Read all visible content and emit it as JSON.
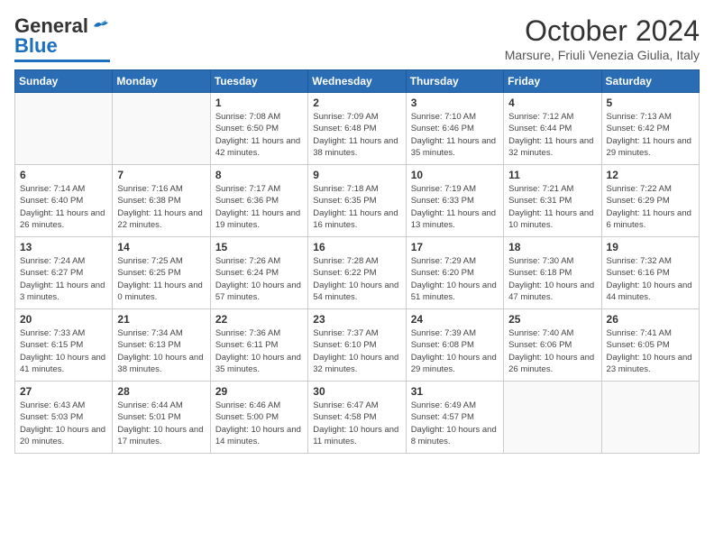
{
  "logo": {
    "general": "General",
    "blue": "Blue"
  },
  "header": {
    "month": "October 2024",
    "location": "Marsure, Friuli Venezia Giulia, Italy"
  },
  "days_of_week": [
    "Sunday",
    "Monday",
    "Tuesday",
    "Wednesday",
    "Thursday",
    "Friday",
    "Saturday"
  ],
  "weeks": [
    [
      {
        "day": "",
        "info": ""
      },
      {
        "day": "",
        "info": ""
      },
      {
        "day": "1",
        "info": "Sunrise: 7:08 AM\nSunset: 6:50 PM\nDaylight: 11 hours and 42 minutes."
      },
      {
        "day": "2",
        "info": "Sunrise: 7:09 AM\nSunset: 6:48 PM\nDaylight: 11 hours and 38 minutes."
      },
      {
        "day": "3",
        "info": "Sunrise: 7:10 AM\nSunset: 6:46 PM\nDaylight: 11 hours and 35 minutes."
      },
      {
        "day": "4",
        "info": "Sunrise: 7:12 AM\nSunset: 6:44 PM\nDaylight: 11 hours and 32 minutes."
      },
      {
        "day": "5",
        "info": "Sunrise: 7:13 AM\nSunset: 6:42 PM\nDaylight: 11 hours and 29 minutes."
      }
    ],
    [
      {
        "day": "6",
        "info": "Sunrise: 7:14 AM\nSunset: 6:40 PM\nDaylight: 11 hours and 26 minutes."
      },
      {
        "day": "7",
        "info": "Sunrise: 7:16 AM\nSunset: 6:38 PM\nDaylight: 11 hours and 22 minutes."
      },
      {
        "day": "8",
        "info": "Sunrise: 7:17 AM\nSunset: 6:36 PM\nDaylight: 11 hours and 19 minutes."
      },
      {
        "day": "9",
        "info": "Sunrise: 7:18 AM\nSunset: 6:35 PM\nDaylight: 11 hours and 16 minutes."
      },
      {
        "day": "10",
        "info": "Sunrise: 7:19 AM\nSunset: 6:33 PM\nDaylight: 11 hours and 13 minutes."
      },
      {
        "day": "11",
        "info": "Sunrise: 7:21 AM\nSunset: 6:31 PM\nDaylight: 11 hours and 10 minutes."
      },
      {
        "day": "12",
        "info": "Sunrise: 7:22 AM\nSunset: 6:29 PM\nDaylight: 11 hours and 6 minutes."
      }
    ],
    [
      {
        "day": "13",
        "info": "Sunrise: 7:24 AM\nSunset: 6:27 PM\nDaylight: 11 hours and 3 minutes."
      },
      {
        "day": "14",
        "info": "Sunrise: 7:25 AM\nSunset: 6:25 PM\nDaylight: 11 hours and 0 minutes."
      },
      {
        "day": "15",
        "info": "Sunrise: 7:26 AM\nSunset: 6:24 PM\nDaylight: 10 hours and 57 minutes."
      },
      {
        "day": "16",
        "info": "Sunrise: 7:28 AM\nSunset: 6:22 PM\nDaylight: 10 hours and 54 minutes."
      },
      {
        "day": "17",
        "info": "Sunrise: 7:29 AM\nSunset: 6:20 PM\nDaylight: 10 hours and 51 minutes."
      },
      {
        "day": "18",
        "info": "Sunrise: 7:30 AM\nSunset: 6:18 PM\nDaylight: 10 hours and 47 minutes."
      },
      {
        "day": "19",
        "info": "Sunrise: 7:32 AM\nSunset: 6:16 PM\nDaylight: 10 hours and 44 minutes."
      }
    ],
    [
      {
        "day": "20",
        "info": "Sunrise: 7:33 AM\nSunset: 6:15 PM\nDaylight: 10 hours and 41 minutes."
      },
      {
        "day": "21",
        "info": "Sunrise: 7:34 AM\nSunset: 6:13 PM\nDaylight: 10 hours and 38 minutes."
      },
      {
        "day": "22",
        "info": "Sunrise: 7:36 AM\nSunset: 6:11 PM\nDaylight: 10 hours and 35 minutes."
      },
      {
        "day": "23",
        "info": "Sunrise: 7:37 AM\nSunset: 6:10 PM\nDaylight: 10 hours and 32 minutes."
      },
      {
        "day": "24",
        "info": "Sunrise: 7:39 AM\nSunset: 6:08 PM\nDaylight: 10 hours and 29 minutes."
      },
      {
        "day": "25",
        "info": "Sunrise: 7:40 AM\nSunset: 6:06 PM\nDaylight: 10 hours and 26 minutes."
      },
      {
        "day": "26",
        "info": "Sunrise: 7:41 AM\nSunset: 6:05 PM\nDaylight: 10 hours and 23 minutes."
      }
    ],
    [
      {
        "day": "27",
        "info": "Sunrise: 6:43 AM\nSunset: 5:03 PM\nDaylight: 10 hours and 20 minutes."
      },
      {
        "day": "28",
        "info": "Sunrise: 6:44 AM\nSunset: 5:01 PM\nDaylight: 10 hours and 17 minutes."
      },
      {
        "day": "29",
        "info": "Sunrise: 6:46 AM\nSunset: 5:00 PM\nDaylight: 10 hours and 14 minutes."
      },
      {
        "day": "30",
        "info": "Sunrise: 6:47 AM\nSunset: 4:58 PM\nDaylight: 10 hours and 11 minutes."
      },
      {
        "day": "31",
        "info": "Sunrise: 6:49 AM\nSunset: 4:57 PM\nDaylight: 10 hours and 8 minutes."
      },
      {
        "day": "",
        "info": ""
      },
      {
        "day": "",
        "info": ""
      }
    ]
  ]
}
